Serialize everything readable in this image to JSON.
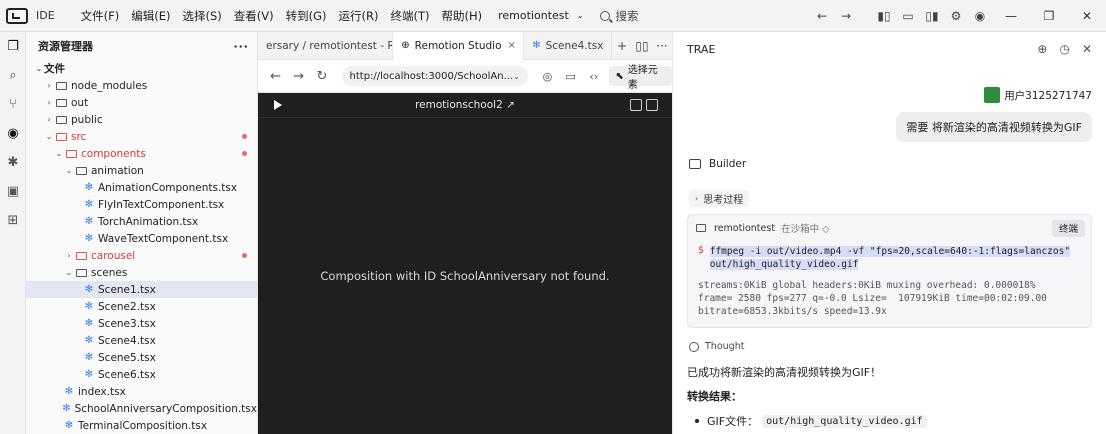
{
  "titlebar": {
    "app_label": "IDE",
    "menus": [
      "文件(F)",
      "编辑(E)",
      "选择(S)",
      "查看(V)",
      "转到(G)",
      "运行(R)",
      "终端(T)",
      "帮助(H)"
    ],
    "project": "remotiontest",
    "search": "搜索"
  },
  "explorer": {
    "title": "资源管理器",
    "more": "···",
    "rows": [
      {
        "label": "文件",
        "chev": "⌄",
        "type": "root",
        "indent": 0
      },
      {
        "label": "node_modules",
        "chev": "›",
        "type": "folder",
        "indent": 1
      },
      {
        "label": "out",
        "chev": "›",
        "type": "folder",
        "indent": 1
      },
      {
        "label": "public",
        "chev": "›",
        "type": "folder",
        "indent": 1
      },
      {
        "label": "src",
        "chev": "⌄",
        "type": "folder-red",
        "indent": 1,
        "dot": true
      },
      {
        "label": "components",
        "chev": "⌄",
        "type": "folder-red",
        "indent": 2,
        "dot": true
      },
      {
        "label": "animation",
        "chev": "⌄",
        "type": "folder",
        "indent": 3
      },
      {
        "label": "AnimationComponents.tsx",
        "type": "file",
        "indent": 4
      },
      {
        "label": "FlyInTextComponent.tsx",
        "type": "file",
        "indent": 4
      },
      {
        "label": "TorchAnimation.tsx",
        "type": "file",
        "indent": 4
      },
      {
        "label": "WaveTextComponent.tsx",
        "type": "file",
        "indent": 4
      },
      {
        "label": "carousel",
        "chev": "›",
        "type": "folder-red",
        "indent": 3,
        "dot": true
      },
      {
        "label": "scenes",
        "chev": "⌄",
        "type": "folder",
        "indent": 3
      },
      {
        "label": "Scene1.tsx",
        "type": "file",
        "indent": 4,
        "selected": true
      },
      {
        "label": "Scene2.tsx",
        "type": "file",
        "indent": 4
      },
      {
        "label": "Scene3.tsx",
        "type": "file",
        "indent": 4
      },
      {
        "label": "Scene4.tsx",
        "type": "file",
        "indent": 4
      },
      {
        "label": "Scene5.tsx",
        "type": "file",
        "indent": 4
      },
      {
        "label": "Scene6.tsx",
        "type": "file",
        "indent": 4
      },
      {
        "label": "index.tsx",
        "type": "file",
        "indent": 2
      },
      {
        "label": "SchoolAnniversaryComposition.tsx",
        "type": "file",
        "indent": 2
      },
      {
        "label": "TerminalComposition.tsx",
        "type": "file",
        "indent": 2
      }
    ]
  },
  "tabs": [
    {
      "label": "ersary / remotiontest - R...",
      "active": false,
      "close": ""
    },
    {
      "label": "Remotion Studio",
      "active": true,
      "close": "×"
    },
    {
      "label": "Scene4.tsx",
      "active": false,
      "close": ""
    }
  ],
  "browser": {
    "url": "http://localhost:3000/SchoolAn...",
    "select_element": "选择元素"
  },
  "preview": {
    "title": "remotionschool2 ↗",
    "message": "Composition with ID SchoolAnniversary not found."
  },
  "chat": {
    "title": "TRAE",
    "user_name": "用户3125271747",
    "user_message": "需要 将新渲染的高清视频转换为GIF",
    "builder_label": "Builder",
    "thinking_label": "思考过程",
    "terminal": {
      "name": "remotiontest",
      "status": "在沙箱中 ◇",
      "end_button": "终端",
      "prompt": "$",
      "command_line1": "ffmpeg -i out/video.mp4 -vf \"fps=20,scale=640:-1:flags=lanczos\"",
      "command_line2": "out/high_quality_video.gif",
      "output_line1": "streams:0KiB global headers:0KiB muxing overhead: 0.000018%",
      "output_line2": "frame= 2580 fps=277 q=-0.0 Lsize=  107919KiB time=00:02:09.00",
      "output_line3": "bitrate=6853.3kbits/s speed=13.9x"
    },
    "thought_label": "Thought",
    "success_text": "已成功将新渲染的高清视频转换为GIF！",
    "result_title": "转换结果：",
    "bullet_label": "GIF文件：",
    "bullet_code": "out/high_quality_video.gif"
  }
}
